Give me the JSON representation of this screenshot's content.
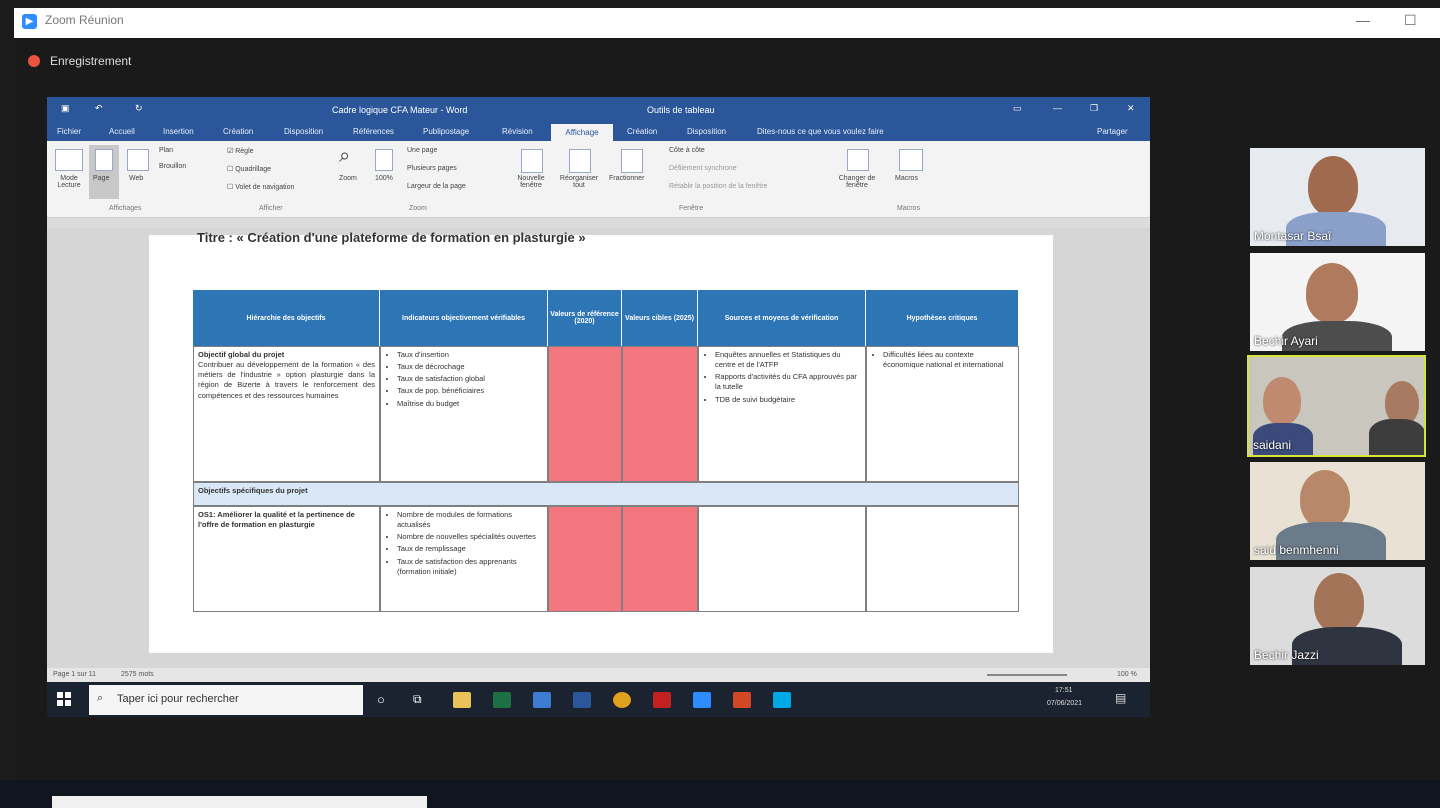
{
  "zoom": {
    "title": "Zoom Réunion",
    "recording_label": "Enregistrement"
  },
  "word": {
    "title": "Cadre logique CFA Mateur - Word",
    "tools_title": "Outils de tableau",
    "tabs": [
      "Fichier",
      "Accueil",
      "Insertion",
      "Création",
      "Disposition",
      "Références",
      "Publipostage",
      "Révision",
      "Affichage",
      "Création",
      "Disposition"
    ],
    "tell_me": "Dites-nous ce que vous voulez faire",
    "share": "Partager",
    "ribbon": {
      "views": [
        "Mode Lecture",
        "Page",
        "Web"
      ],
      "views_small": [
        "Plan",
        "Brouillon"
      ],
      "views_group": "Affichages",
      "show": [
        "Règle",
        "Quadrillage",
        "Volet de navigation"
      ],
      "show_group": "Afficher",
      "zoom_buttons": [
        "Zoom",
        "100%"
      ],
      "zoom_small": [
        "Une page",
        "Plusieurs pages",
        "Largeur de la page"
      ],
      "zoom_group": "Zoom",
      "window_buttons": [
        "Nouvelle fenêtre",
        "Réorganiser tout",
        "Fractionner"
      ],
      "window_small": [
        "Côte à côte",
        "Défilement synchrone",
        "Rétablir la position de la fenêtre"
      ],
      "switch_windows": "Changer de fenêtre",
      "window_group": "Fenêtre",
      "macros": "Macros",
      "macros_group": "Macros"
    },
    "doc": {
      "heading": "Titre : « Création d'une plateforme de formation en plasturgie »",
      "columns": [
        "Hiérarchie des objectifs",
        "Indicateurs objectivement vérifiables",
        "Valeurs de référence (2020)",
        "Valeurs cibles (2025)",
        "Sources et moyens de vérification",
        "Hypothèses critiques"
      ],
      "row1": {
        "objective_title": "Objectif global du projet",
        "objective_text": "Contribuer au développement de la formation « des métiers de l'industrie » option plasturgie dans la région de Bizerte à travers le renforcement des compétences et des ressources humaines",
        "indicators": [
          "Taux d'insertion",
          "Taux de décrochage",
          "Taux de satisfaction global",
          "Taux de pop. bénéficiaires",
          "Maîtrise du budget"
        ],
        "sources": [
          "Enquêtes annuelles et Statistiques du centre et de l'ATFP",
          "Rapports d'activités du CFA approuvés par la tutelle",
          "TDB de suivi budgétaire"
        ],
        "hypotheses": [
          "Difficultés liées au contexte économique national et international"
        ]
      },
      "subheader": "Objectifs spécifiques du projet",
      "row2": {
        "objective_text": "OS1: Améliorer la qualité et la pertinence de l'offre de formation en plasturgie",
        "indicators": [
          "Nombre de modules de formations actualisés",
          "Nombre de nouvelles spécialités ouvertes",
          "Taux de remplissage",
          "Taux de satisfaction des apprenants (formation initiale)"
        ]
      }
    },
    "status": {
      "page": "Page 1 sur 11",
      "words": "2575 mots",
      "zoom": "100 %"
    }
  },
  "taskbar": {
    "search_placeholder": "Taper ici pour rechercher",
    "time": "17:51",
    "date": "07/06/2021"
  },
  "participants": [
    {
      "name": "Montasar Bsaï"
    },
    {
      "name": "Bechir Ayari"
    },
    {
      "name": "saidani"
    },
    {
      "name": "said benmhenni"
    },
    {
      "name": "Bechir Jazzi"
    }
  ],
  "colors": {
    "word_blue": "#2b579a",
    "table_header": "#2e75b6",
    "red_cells": "#f4777f",
    "active_speaker": "#d6e53c"
  }
}
